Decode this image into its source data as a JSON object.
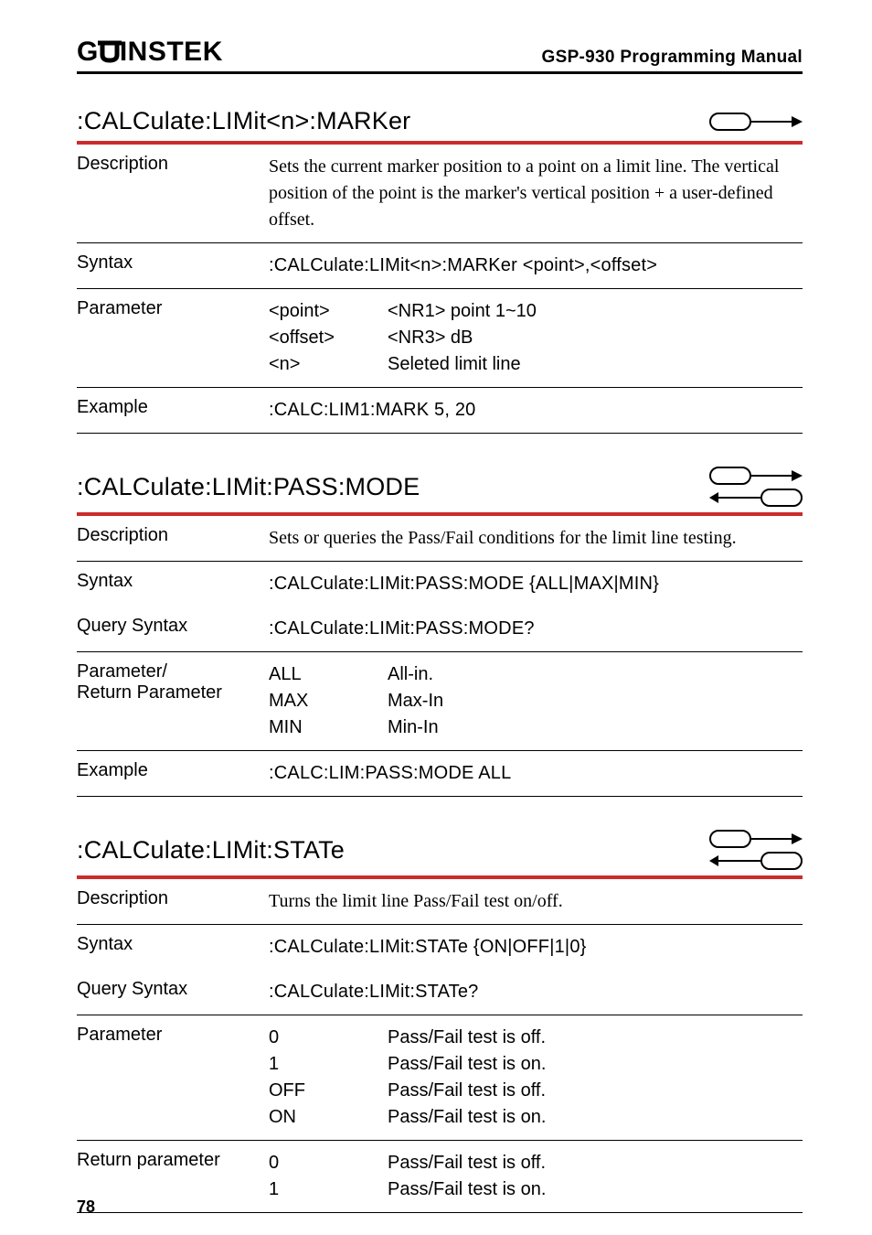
{
  "header": {
    "manual_title": "GSP-930 Programming Manual",
    "logo_a": "G",
    "logo_b": "INSTEK"
  },
  "page_number": "78",
  "sections": [
    {
      "title": ":CALCulate:LIMit<n>:MARKer",
      "icons": "set",
      "rows": [
        {
          "label": "Description",
          "value": "Sets the current marker position to a point on a limit line. The vertical position of the point is the marker's vertical position + a user-defined offset.",
          "serif": true
        },
        {
          "label": "Syntax",
          "value": ":CALCulate:LIMit<n>:MARKer <point>,<offset>"
        },
        {
          "label": "Parameter",
          "params": [
            {
              "k": "<point>",
              "v": "<NR1> point 1~10"
            },
            {
              "k": "<offset>",
              "v": "<NR3> dB"
            },
            {
              "k": "<n>",
              "v": "Seleted limit line"
            }
          ]
        },
        {
          "label": "Example",
          "value": ":CALC:LIM1:MARK 5, 20"
        }
      ]
    },
    {
      "title": ":CALCulate:LIMit:PASS:MODE",
      "icons": "setquery",
      "rows": [
        {
          "label": "Description",
          "value": "Sets or queries the Pass/Fail conditions for the limit line testing.",
          "serif": true
        },
        {
          "label": "Syntax",
          "value": ":CALCulate:LIMit:PASS:MODE {ALL|MAX|MIN}",
          "no_rule": true
        },
        {
          "label": "Query Syntax",
          "value": ":CALCulate:LIMit:PASS:MODE?"
        },
        {
          "label": "Parameter/\nReturn Parameter",
          "params": [
            {
              "k": "ALL",
              "v": "All-in."
            },
            {
              "k": "MAX",
              "v": "Max-In"
            },
            {
              "k": "MIN",
              "v": "Min-In"
            }
          ]
        },
        {
          "label": "Example",
          "value": ":CALC:LIM:PASS:MODE ALL"
        }
      ]
    },
    {
      "title": ":CALCulate:LIMit:STATe",
      "icons": "setquery",
      "rows": [
        {
          "label": "Description",
          "value": "Turns the limit line Pass/Fail test on/off.",
          "serif": true
        },
        {
          "label": "Syntax",
          "value": ":CALCulate:LIMit:STATe {ON|OFF|1|0}",
          "no_rule": true
        },
        {
          "label": "Query Syntax",
          "value": ":CALCulate:LIMit:STATe?"
        },
        {
          "label": "Parameter",
          "params": [
            {
              "k": "0",
              "v": "Pass/Fail test is off."
            },
            {
              "k": "1",
              "v": "Pass/Fail test is on."
            },
            {
              "k": "OFF",
              "v": "Pass/Fail test is off."
            },
            {
              "k": "ON",
              "v": "Pass/Fail test is on."
            }
          ]
        },
        {
          "label": "Return parameter",
          "params": [
            {
              "k": "0",
              "v": "Pass/Fail test is off."
            },
            {
              "k": "1",
              "v": "Pass/Fail test is on."
            }
          ]
        }
      ]
    }
  ]
}
